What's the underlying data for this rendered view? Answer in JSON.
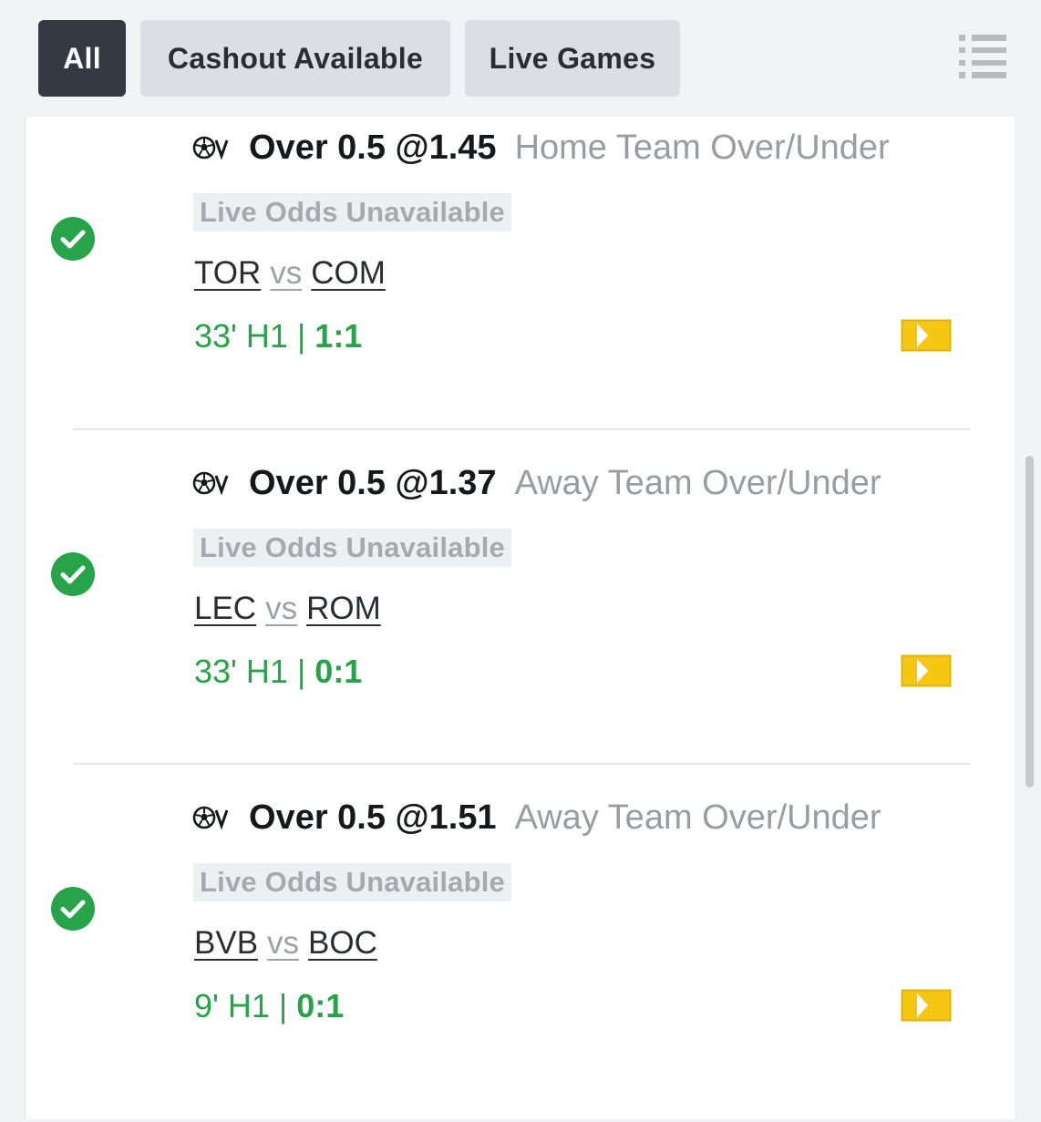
{
  "filters": {
    "all_label": "All",
    "cashout_label": "Cashout Available",
    "live_label": "Live Games",
    "active": "All"
  },
  "colors": {
    "active_filter": "#343a44",
    "inactive_filter": "#dcdee3",
    "win_green": "#27a349",
    "live_green": "#27a349",
    "stream_yellow": "#f6c712"
  },
  "bets": [
    {
      "sport_icon": "soccer-virtual-icon",
      "status_icon": "check-circle-icon",
      "selection": "Over 0.5 @1.45",
      "market": "Home Team Over/Under",
      "odds_status": "Live Odds Unavailable",
      "home": "TOR",
      "vs": "vs",
      "away": "COM",
      "clock": "33' H1 | ",
      "score": "1:1",
      "stream_icon": "live-stream-icon"
    },
    {
      "sport_icon": "soccer-virtual-icon",
      "status_icon": "check-circle-icon",
      "selection": "Over 0.5 @1.37",
      "market": "Away Team Over/Under",
      "odds_status": "Live Odds Unavailable",
      "home": "LEC",
      "vs": "vs",
      "away": "ROM",
      "clock": "33' H1 | ",
      "score": "0:1",
      "stream_icon": "live-stream-icon"
    },
    {
      "sport_icon": "soccer-virtual-icon",
      "status_icon": "check-circle-icon",
      "selection": "Over 0.5 @1.51",
      "market": "Away Team Over/Under",
      "odds_status": "Live Odds Unavailable",
      "home": "BVB",
      "vs": "vs",
      "away": "BOC",
      "clock": "9' H1 | ",
      "score": "0:1",
      "stream_icon": "live-stream-icon"
    }
  ]
}
